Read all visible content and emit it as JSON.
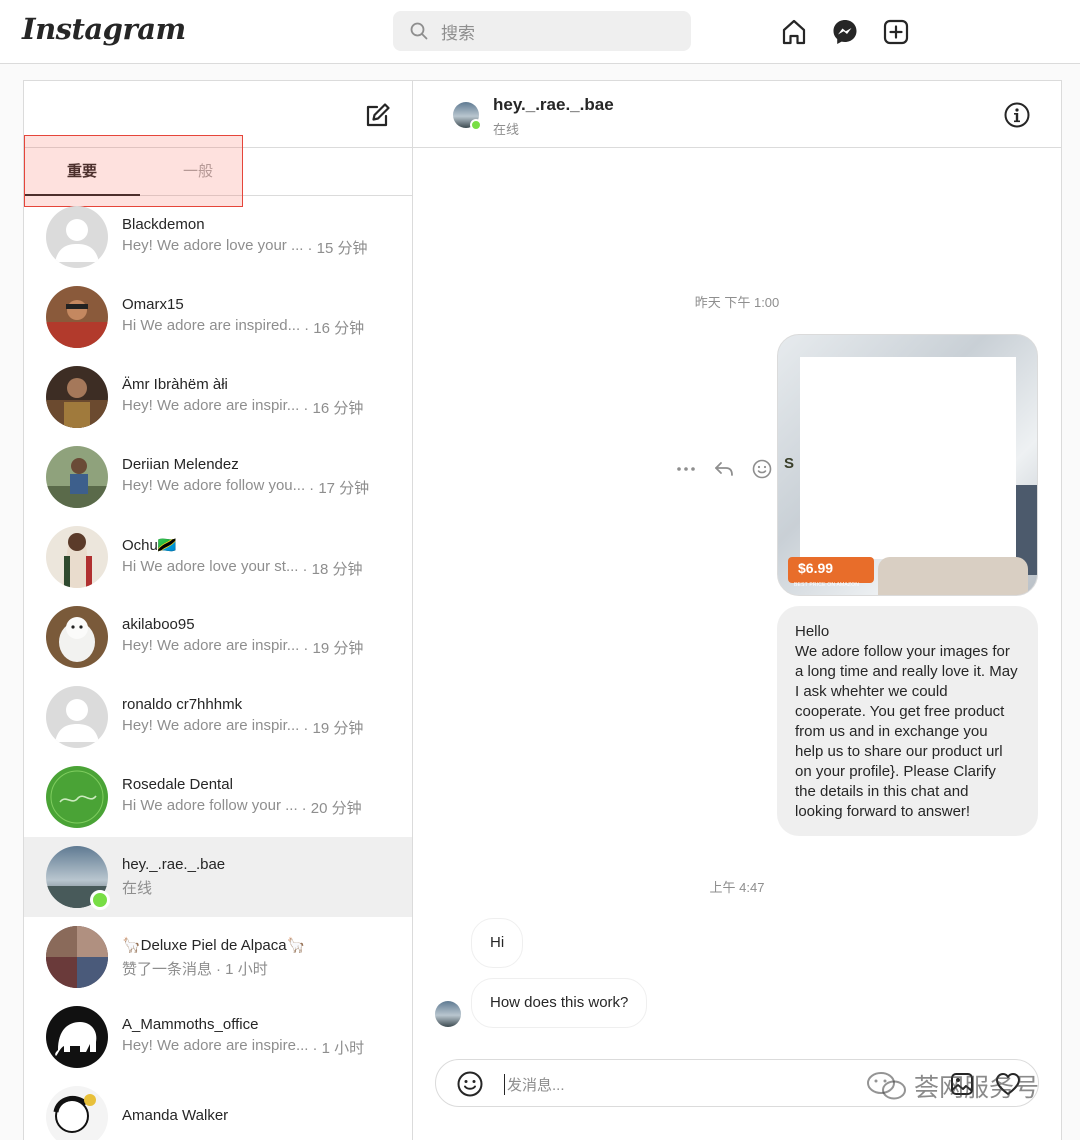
{
  "nav": {
    "logo": "Instagram",
    "search_placeholder": "搜索",
    "icons": [
      "home-icon",
      "messenger-icon",
      "new-post-icon"
    ]
  },
  "inbox": {
    "tabs": {
      "primary": "重要",
      "general": "一般"
    },
    "threads": [
      {
        "name": "Blackdemon",
        "preview": "Hey! We adore love your ...",
        "time": "· 15 分钟"
      },
      {
        "name": "Omarx15",
        "preview": "Hi  We adore are inspired...",
        "time": "· 16 分钟"
      },
      {
        "name": "Ämr Ibràhëm àłi",
        "preview": "Hey! We adore are inspir...",
        "time": "· 16 分钟"
      },
      {
        "name": "Deriian Melendez",
        "preview": "Hey! We adore follow you...",
        "time": "· 17 分钟"
      },
      {
        "name": "Ochu🇹🇿",
        "preview": "Hi  We adore love your st...",
        "time": "· 18 分钟"
      },
      {
        "name": "akilaboo95",
        "preview": "Hey! We adore are inspir...",
        "time": "· 19 分钟"
      },
      {
        "name": "ronaldo cr7hhhmk",
        "preview": "Hey! We adore are inspir...",
        "time": "· 19 分钟"
      },
      {
        "name": "Rosedale Dental",
        "preview": "Hi  We adore follow your ...",
        "time": "· 20 分钟"
      },
      {
        "name": "hey._.rae._.bae",
        "preview": "在线",
        "time": ""
      },
      {
        "name": "🦙Deluxe Piel de Alpaca🦙",
        "preview": "赞了一条消息",
        "time": "· 1 小时"
      },
      {
        "name": "A_Mammoths_office",
        "preview": "Hey! We adore are inspire...",
        "time": "· 1 小时"
      },
      {
        "name": "Amanda Walker",
        "preview": "",
        "time": ""
      }
    ]
  },
  "chat": {
    "name": "hey._.rae._.bae",
    "status": "在线",
    "timestamp1": "昨天 下午 1:00",
    "image_price": "$6.99",
    "image_price_note": "BEST PRICE ON AMAZON",
    "outgoing_text": "Hello\nWe adore follow your images for a long time and really love it. May I ask whehter we could cooperate. You get free product from us and in exchange you help us to share our product url on your profile}. Please Clarify the details in this chat and looking forward to answer!",
    "timestamp2": "上午 4:47",
    "incoming": [
      "Hi",
      "How does this work?"
    ],
    "composer_placeholder": "发消息..."
  },
  "watermark": "荟网服务号",
  "colors": {
    "online": "#78de45",
    "highlight_border": "#e5453a",
    "price_tag": "#e86d2a"
  }
}
